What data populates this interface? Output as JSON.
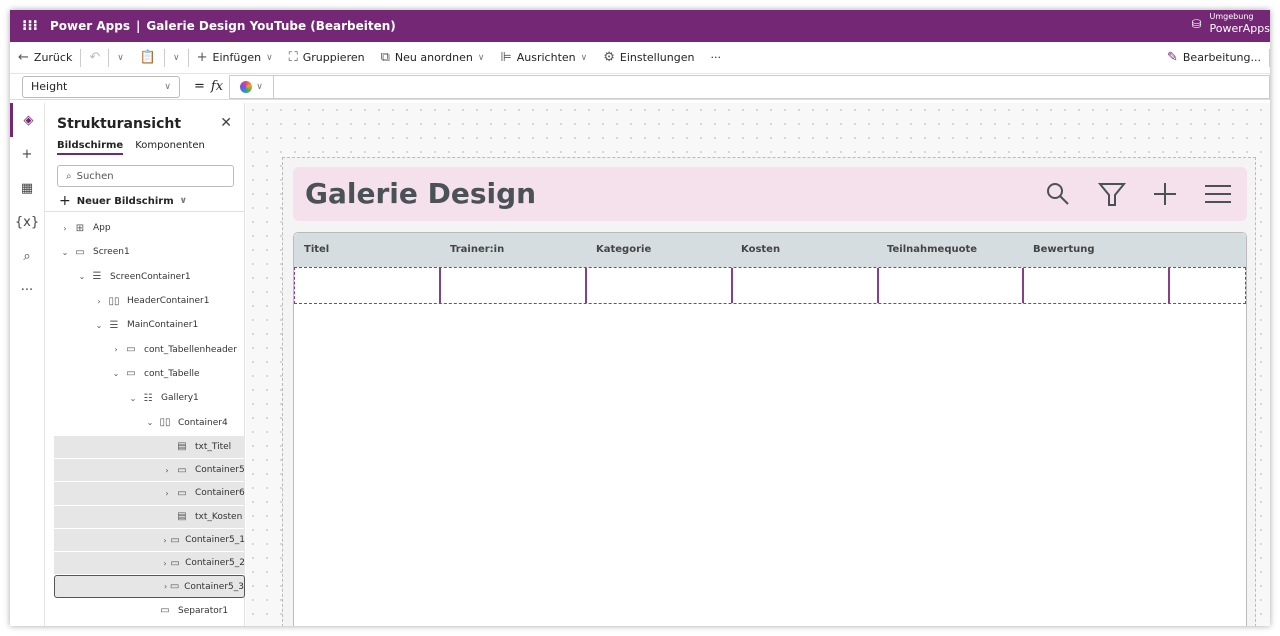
{
  "titlebar": {
    "app": "Power Apps",
    "separator": "|",
    "doc": "Galerie Design YouTube (Bearbeiten)",
    "env_label": "Umgebung",
    "env_value": "PowerApps"
  },
  "toolbar": {
    "back": "Zurück",
    "insert": "Einfügen",
    "group": "Gruppieren",
    "arrange": "Neu anordnen",
    "align": "Ausrichten",
    "settings": "Einstellungen",
    "more": "···",
    "edit": "Bearbeitung..."
  },
  "formula": {
    "property": "Height",
    "eq": "=",
    "fx": "fx",
    "value": ""
  },
  "panel": {
    "title": "Strukturansicht",
    "tabs": [
      "Bildschirme",
      "Komponenten"
    ],
    "search_placeholder": "Suchen",
    "new_screen": "Neuer Bildschirm",
    "tree": [
      {
        "label": "App",
        "level": 0,
        "caret": ">",
        "icon": "⊞"
      },
      {
        "label": "Screen1",
        "level": 0,
        "caret": "v",
        "icon": "▭"
      },
      {
        "label": "ScreenContainer1",
        "level": 1,
        "caret": "v",
        "icon": "☰"
      },
      {
        "label": "HeaderContainer1",
        "level": 2,
        "caret": ">",
        "icon": "▯▯"
      },
      {
        "label": "MainContainer1",
        "level": 2,
        "caret": "v",
        "icon": "☰"
      },
      {
        "label": "cont_Tabellenheader",
        "level": 3,
        "caret": ">",
        "icon": "▭"
      },
      {
        "label": "cont_Tabelle",
        "level": 3,
        "caret": "v",
        "icon": "▭"
      },
      {
        "label": "Gallery1",
        "level": 4,
        "caret": "v",
        "icon": "☷"
      },
      {
        "label": "Container4",
        "level": 5,
        "caret": "v",
        "icon": "▯▯"
      },
      {
        "label": "txt_Titel",
        "level": 6,
        "caret": "",
        "icon": "▤",
        "hl": true
      },
      {
        "label": "Container5",
        "level": 6,
        "caret": ">",
        "icon": "▭",
        "hl": true
      },
      {
        "label": "Container6",
        "level": 6,
        "caret": ">",
        "icon": "▭",
        "hl": true
      },
      {
        "label": "txt_Kosten",
        "level": 6,
        "caret": "",
        "icon": "▤",
        "hl": true
      },
      {
        "label": "Container5_1",
        "level": 6,
        "caret": ">",
        "icon": "▭",
        "hl": true
      },
      {
        "label": "Container5_2",
        "level": 6,
        "caret": ">",
        "icon": "▭",
        "hl": true
      },
      {
        "label": "Container5_3",
        "level": 6,
        "caret": ">",
        "icon": "▭",
        "hl": true,
        "sel": true
      },
      {
        "label": "Separator1",
        "level": 5,
        "caret": "",
        "icon": "▭"
      }
    ]
  },
  "canvas": {
    "title": "Galerie Design",
    "columns": [
      "Titel",
      "Trainer:in",
      "Kategorie",
      "Kosten",
      "Teilnahmequote",
      "Bewertung"
    ]
  },
  "colors": {
    "brand": "#742774",
    "header_bg": "#f4e1ec",
    "table_header": "#d6dde0"
  }
}
